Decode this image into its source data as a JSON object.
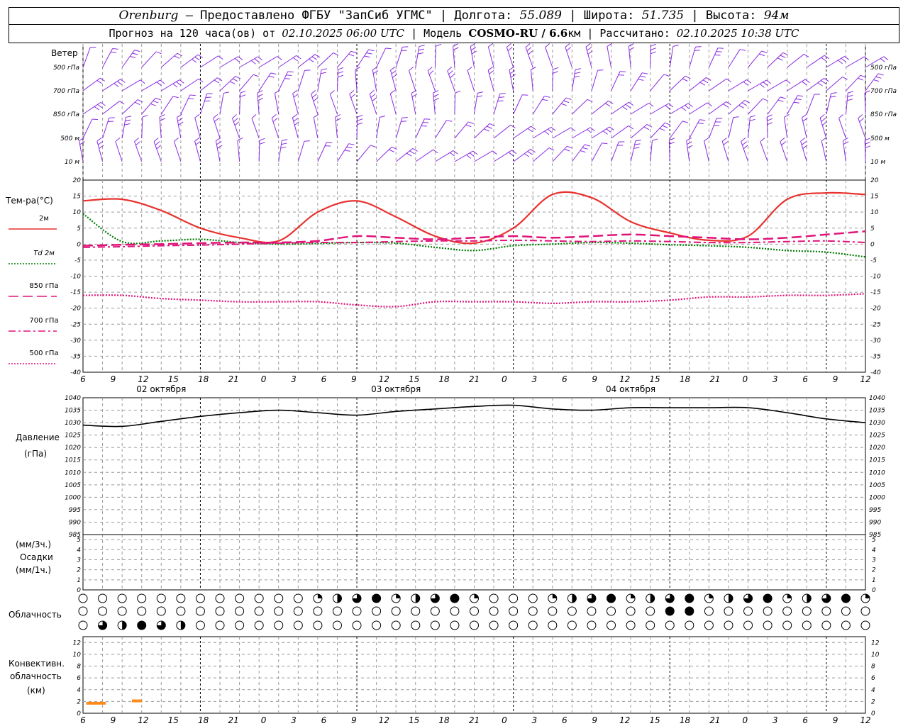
{
  "header": {
    "station": "Orenburg",
    "provided": "— Предоставлено ФГБУ \"ЗапСиб УГМС\" | Долгота:",
    "lon": "55.089",
    "lat_label": "| Широта:",
    "lat": "51.735",
    "alt_label": "| Высота:",
    "alt": "94м",
    "forecast_prefix": "Прогноз на 120 часа(ов) от",
    "forecast_start": "02.10.2025 06:00 UTC",
    "model_label": "| Модель",
    "model": "COSMO-RU / 6.6",
    "model_unit": "км",
    "calc_label": "| Рассчитано:",
    "calc_time": "02.10.2025 10:38 UTC"
  },
  "wind_panel": {
    "title": "Ветер",
    "levels": [
      "500 гПа",
      "700 гПа",
      "850 гПа",
      "500 м",
      "10  м"
    ],
    "barb_color": "#8a2be2"
  },
  "temp_panel": {
    "title": "Тем-ра(°C)",
    "legend": [
      {
        "label": "2м",
        "style": "solid",
        "color": "#e8322e"
      },
      {
        "label": "Td  2м",
        "style": "dotted",
        "color": "#007a00"
      },
      {
        "label": "850 гПа",
        "style": "long-dash",
        "color": "#e0137a"
      },
      {
        "label": "700 гПа",
        "style": "dash-dot",
        "color": "#e0137a"
      },
      {
        "label": "500 гПа",
        "style": "fine-dash",
        "color": "#e0137a"
      }
    ],
    "yticks": [
      "20",
      "15",
      "10",
      "5",
      "0",
      "-5",
      "-10",
      "-15",
      "-20",
      "-25",
      "-30",
      "-35",
      "-40"
    ]
  },
  "time_axis": {
    "hours": [
      "6",
      "9",
      "12",
      "15",
      "18",
      "21",
      "0",
      "3",
      "6",
      "9",
      "12",
      "15",
      "18",
      "21",
      "0",
      "3",
      "6",
      "9",
      "12",
      "15",
      "18",
      "21",
      "0",
      "3",
      "6",
      "9",
      "12"
    ],
    "dates": [
      "02 октября",
      "03 октября",
      "04 октября"
    ]
  },
  "pressure_panel": {
    "label1": "Давление",
    "label2": "(гПа)",
    "yticks": [
      "1040",
      "1035",
      "1030",
      "1025",
      "1020",
      "1015",
      "1010",
      "1005",
      "1000",
      "995",
      "990",
      "985"
    ]
  },
  "precip_panel": {
    "label1": "(мм/3ч.)",
    "label2": "Осадки",
    "label3": "(мм/1ч.)",
    "yticks": [
      "5",
      "4",
      "3",
      "2",
      "1",
      "0"
    ]
  },
  "cloud_panel": {
    "label": "Облачность",
    "rows": [
      "high",
      "middle",
      "low"
    ]
  },
  "conv_panel": {
    "label1": "Конвективн.",
    "label2": "облачность",
    "label3": "(км)",
    "yticks": [
      "12",
      "10",
      "8",
      "6",
      "4",
      "2",
      "0"
    ],
    "bar_color": "#ff8c1a"
  },
  "chart_data": [
    {
      "type": "line",
      "title": "Тем-ра(°C)",
      "x_hours": [
        0,
        6,
        12,
        18,
        24,
        30,
        36,
        42,
        48,
        54,
        60,
        66,
        72,
        78,
        84,
        90,
        96,
        102,
        108,
        114,
        120
      ],
      "ylim": [
        -40,
        20
      ],
      "series": [
        {
          "name": "2м",
          "values": [
            13.5,
            14.0,
            10.5,
            5.0,
            2.0,
            1.0,
            10.0,
            13.5,
            8.5,
            2.5,
            0.3,
            5.0,
            15.5,
            14.5,
            7.0,
            3.5,
            1.2,
            2.5,
            14.0,
            16.0,
            15.5
          ]
        },
        {
          "name": "Td 2м",
          "values": [
            9.5,
            0.8,
            1.0,
            1.5,
            0.5,
            0.0,
            0.2,
            0.5,
            0.3,
            -1.0,
            -2.0,
            -0.5,
            0.0,
            0.5,
            0.3,
            -0.2,
            -0.5,
            -1.0,
            -2.0,
            -2.5,
            -4.0
          ]
        },
        {
          "name": "850 гПа",
          "values": [
            -0.5,
            -0.2,
            0.0,
            0.3,
            0.5,
            0.5,
            1.0,
            2.5,
            2.0,
            1.5,
            2.0,
            2.5,
            2.0,
            2.5,
            3.0,
            2.5,
            2.0,
            1.5,
            2.0,
            3.0,
            4.0
          ]
        },
        {
          "name": "700 гПа",
          "values": [
            -1.0,
            -0.8,
            -0.5,
            -0.3,
            0.0,
            0.3,
            0.5,
            0.5,
            0.8,
            1.0,
            1.0,
            1.2,
            1.0,
            0.8,
            1.0,
            0.8,
            0.5,
            0.5,
            0.8,
            1.0,
            0.5
          ]
        },
        {
          "name": "500 гПа",
          "values": [
            -16.0,
            -16.0,
            -17.0,
            -17.5,
            -18.0,
            -18.0,
            -18.0,
            -19.0,
            -19.5,
            -18.0,
            -18.0,
            -18.0,
            -18.5,
            -18.0,
            -18.0,
            -17.5,
            -16.5,
            -16.5,
            -16.0,
            -16.0,
            -15.5
          ]
        }
      ]
    },
    {
      "type": "line",
      "title": "Давление",
      "x_hours": [
        0,
        6,
        12,
        18,
        24,
        30,
        36,
        42,
        48,
        54,
        60,
        66,
        72,
        78,
        84,
        90,
        96,
        102,
        108,
        114,
        120
      ],
      "ylim": [
        985,
        1040
      ],
      "series": [
        {
          "name": "Давление",
          "values": [
            1029.0,
            1028.5,
            1030.5,
            1032.5,
            1034.0,
            1035.0,
            1034.0,
            1033.0,
            1034.5,
            1035.5,
            1036.5,
            1037.0,
            1035.5,
            1035.0,
            1036.0,
            1036.0,
            1036.0,
            1036.0,
            1034.0,
            1031.5,
            1030.0
          ]
        }
      ]
    },
    {
      "type": "bar",
      "title": "Конвективн. облачность (км)",
      "ylim": [
        0,
        13
      ],
      "segments": [
        {
          "x_start": 0.5,
          "x_end": 3.5,
          "value": 1.7
        },
        {
          "x_start": 7.5,
          "x_end": 9.0,
          "value": 2.1
        }
      ]
    }
  ]
}
